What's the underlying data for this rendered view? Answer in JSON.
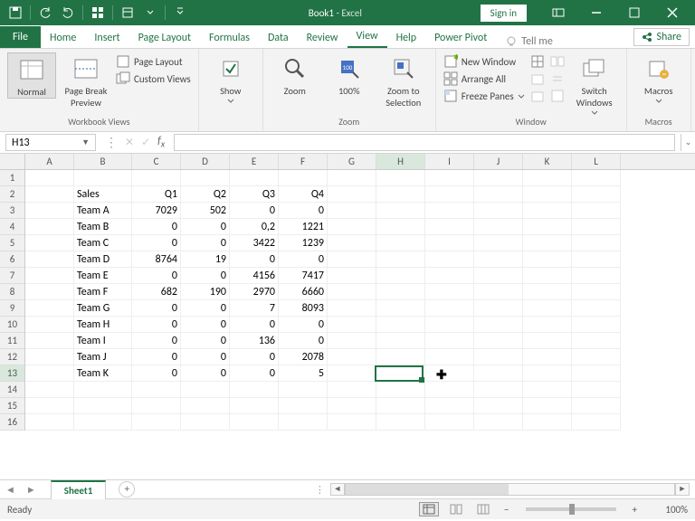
{
  "titlebar": {
    "doc": "Book1",
    "sep": " - ",
    "app": "Excel",
    "signin": "Sign in"
  },
  "tabs": {
    "file": "File",
    "home": "Home",
    "insert": "Insert",
    "pagelayout": "Page Layout",
    "formulas": "Formulas",
    "data": "Data",
    "review": "Review",
    "view": "View",
    "help": "Help",
    "powerpivot": "Power Pivot",
    "tellme": "Tell me",
    "share": "Share"
  },
  "ribbon": {
    "views_group": "Workbook Views",
    "normal": "Normal",
    "pagebreak": "Page Break Preview",
    "page_layout": "Page Layout",
    "custom_views": "Custom Views",
    "show": "Show",
    "zoom_group": "Zoom",
    "zoom": "Zoom",
    "hundred": "100%",
    "zoom_sel": "Zoom to Selection",
    "window_group": "Window",
    "new_window": "New Window",
    "arrange_all": "Arrange All",
    "freeze": "Freeze Panes",
    "switch": "Switch Windows",
    "macros_group": "Macros",
    "macros": "Macros"
  },
  "namebox": "H13",
  "columns": [
    "A",
    "B",
    "C",
    "D",
    "E",
    "F",
    "G",
    "H",
    "I",
    "J",
    "K",
    "L"
  ],
  "rows": [
    "1",
    "2",
    "3",
    "4",
    "5",
    "6",
    "7",
    "8",
    "9",
    "10",
    "11",
    "12",
    "13",
    "14",
    "15",
    "16"
  ],
  "chart_data": {
    "type": "table",
    "title": "Sales",
    "categories": [
      "Q1",
      "Q2",
      "Q3",
      "Q4"
    ],
    "series": [
      {
        "name": "Team A",
        "values": [
          7029,
          502,
          0,
          0
        ]
      },
      {
        "name": "Team B",
        "values": [
          0,
          0,
          "0,2",
          1221
        ]
      },
      {
        "name": "Team C",
        "values": [
          0,
          0,
          3422,
          1239
        ]
      },
      {
        "name": "Team D",
        "values": [
          8764,
          19,
          0,
          0
        ]
      },
      {
        "name": "Team E",
        "values": [
          0,
          0,
          4156,
          7417
        ]
      },
      {
        "name": "Team F",
        "values": [
          682,
          190,
          2970,
          6660
        ]
      },
      {
        "name": "Team G",
        "values": [
          0,
          0,
          7,
          8093
        ]
      },
      {
        "name": "Team H",
        "values": [
          0,
          0,
          0,
          0
        ]
      },
      {
        "name": "Team I",
        "values": [
          0,
          0,
          136,
          0
        ]
      },
      {
        "name": "Team J",
        "values": [
          0,
          0,
          0,
          2078
        ]
      },
      {
        "name": "Team K",
        "values": [
          0,
          0,
          0,
          5
        ]
      }
    ]
  },
  "sheettab": "Sheet1",
  "status": {
    "ready": "Ready",
    "zoom": "100%"
  }
}
